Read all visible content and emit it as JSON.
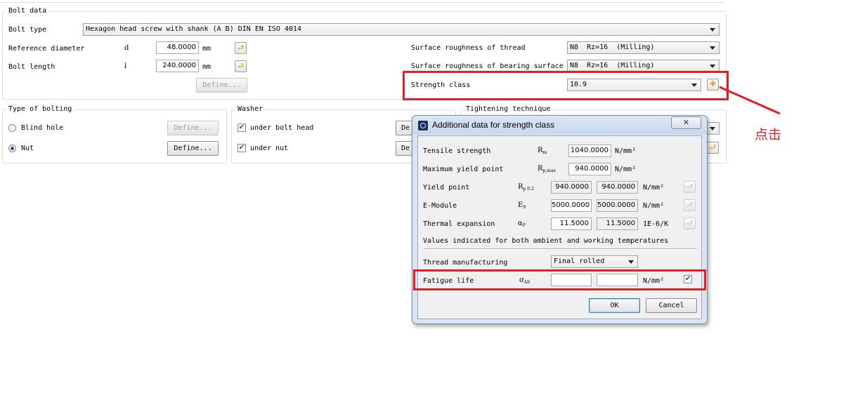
{
  "bolt_data": {
    "title": "Bolt data",
    "bolt_type_label": "Bolt type",
    "bolt_type_value": "Hexagon head screw with shank (A B) DIN EN ISO 4014",
    "ref_diam_label": "Reference diameter",
    "ref_diam_symbol": "d",
    "ref_diam_value": "48.0000",
    "ref_diam_unit": "mm",
    "bolt_length_label": "Bolt length",
    "bolt_length_symbol": "l",
    "bolt_length_value": "240.0000",
    "bolt_length_unit": "mm",
    "define_label": "Define...",
    "rough_thread_label": "Surface roughness of thread",
    "rough_thread_value": "N8  Rz=16  (Milling)",
    "rough_bearing_label": "Surface roughness of bearing surface",
    "rough_bearing_value": "N8  Rz=16  (Milling)",
    "strength_label": "Strength class",
    "strength_value": "10.9"
  },
  "type_of_bolting": {
    "title": "Type of bolting",
    "blind_hole": "Blind hole",
    "nut": "Nut",
    "define1": "Define...",
    "define2": "Define...",
    "selected": "Nut"
  },
  "washer": {
    "title": "Washer",
    "under_head": "under bolt head",
    "under_nut": "under nut",
    "define1": "De",
    "define2": "De"
  },
  "tightening": {
    "title": "Tightening technique"
  },
  "dialog": {
    "title": "Additional data for strength class",
    "close": "✕",
    "tensile_label": "Tensile strength",
    "tensile_sym": "R",
    "tensile_sub": "m",
    "tensile_value": "1040.0000",
    "max_yield_label": "Maximum yield point",
    "max_yield_sym": "R",
    "max_yield_sub": "p,max",
    "max_yield_value": "940.0000",
    "yield_label": "Yield point",
    "yield_sym": "R",
    "yield_sub": "p 0.2",
    "yield_value1": "940.0000",
    "yield_value2": "940.0000",
    "emod_label": "E-Module",
    "emod_sym": "E",
    "emod_sub": "S",
    "emod_value1": "5000.0000",
    "emod_value2": "5000.0000",
    "thermal_label": "Thermal expansion",
    "thermal_sym": "α",
    "thermal_sub": "P",
    "thermal_value1": "11.5000",
    "thermal_value2": "11.5000",
    "thermal_unit": "1E-6/K",
    "unit_nmm2": "N/mm²",
    "note": "Values indicated for both ambient and working temperatures",
    "thread_mfg_label": "Thread manufacturing",
    "thread_mfg_value": "Final rolled",
    "fatigue_label": "Fatigue life",
    "fatigue_sym": "σ",
    "fatigue_sub": "AS",
    "fatigue_value1": "",
    "fatigue_value2": "",
    "ok": "OK",
    "cancel": "Cancel"
  },
  "annotation": {
    "text": "点击",
    "color": "#e31e24"
  }
}
